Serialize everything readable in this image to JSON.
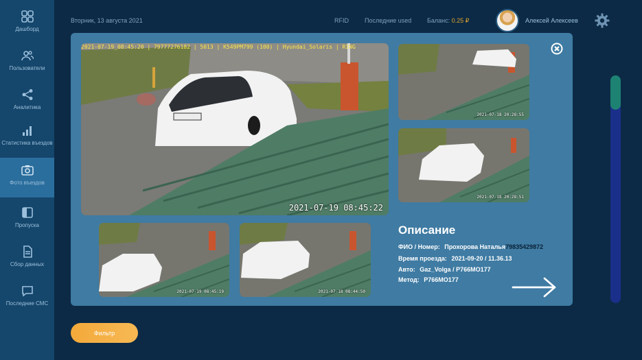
{
  "sidebar": {
    "items": [
      {
        "label": "Дашборд",
        "icon": "dashboard-icon"
      },
      {
        "label": "Пользователи",
        "icon": "users-icon"
      },
      {
        "label": "Аналитика",
        "icon": "share-icon"
      },
      {
        "label": "Статистика въездов",
        "icon": "bar-chart-icon"
      },
      {
        "label": "Фото въездов",
        "icon": "camera-icon"
      },
      {
        "label": "Пропуска",
        "icon": "pass-icon"
      },
      {
        "label": "Сбор данных",
        "icon": "document-icon"
      },
      {
        "label": "Последние СМС",
        "icon": "chat-icon"
      }
    ],
    "active_index": 4
  },
  "header": {
    "date": "Вторник, 13 августа 2021",
    "rfid": "RFID",
    "last_used": "Последние used",
    "balance_label": "Баланс:",
    "balance_value": "0.25 ₽",
    "user_name": "Алексей Алексеев"
  },
  "filter_button": "Фильтр",
  "modal": {
    "main_photo": {
      "overlay": "2021-07-19_08:45:20 | 79777276182 | 5013 | К549РМ799 (100) | Hyundai_Solaris | RING",
      "timestamp": "2021-07-19 08:45:22"
    },
    "thumbs": [
      {
        "timestamp": "2021-07-18 20:28:55"
      },
      {
        "timestamp": "2021-07-18 20:28:51"
      },
      {
        "timestamp": "2021-07-19 08:45:19"
      },
      {
        "timestamp": "2021-07-18 08:44:50"
      }
    ],
    "description": {
      "title": "Описание",
      "fio_label": "ФИО / Номер:",
      "fio_value": "Прохорова Наталья",
      "phone": "79835429872",
      "time_label": "Время проезда:",
      "time_value": "2021-09-20 / 11.36.13",
      "auto_label": "Авто:",
      "auto_value": "Gaz_Volga / Р766МО177",
      "method_label": "Метод:",
      "method_value": "Р766МО177"
    }
  },
  "colors": {
    "background": "#0c2a45",
    "sidebar": "#15466b",
    "sidebar_active": "#2a6e9d",
    "modal": "#3f7ba3",
    "accent_orange": "#f3a93a",
    "balance": "#e1a32c",
    "scroll_thumb": "#1e8272"
  }
}
